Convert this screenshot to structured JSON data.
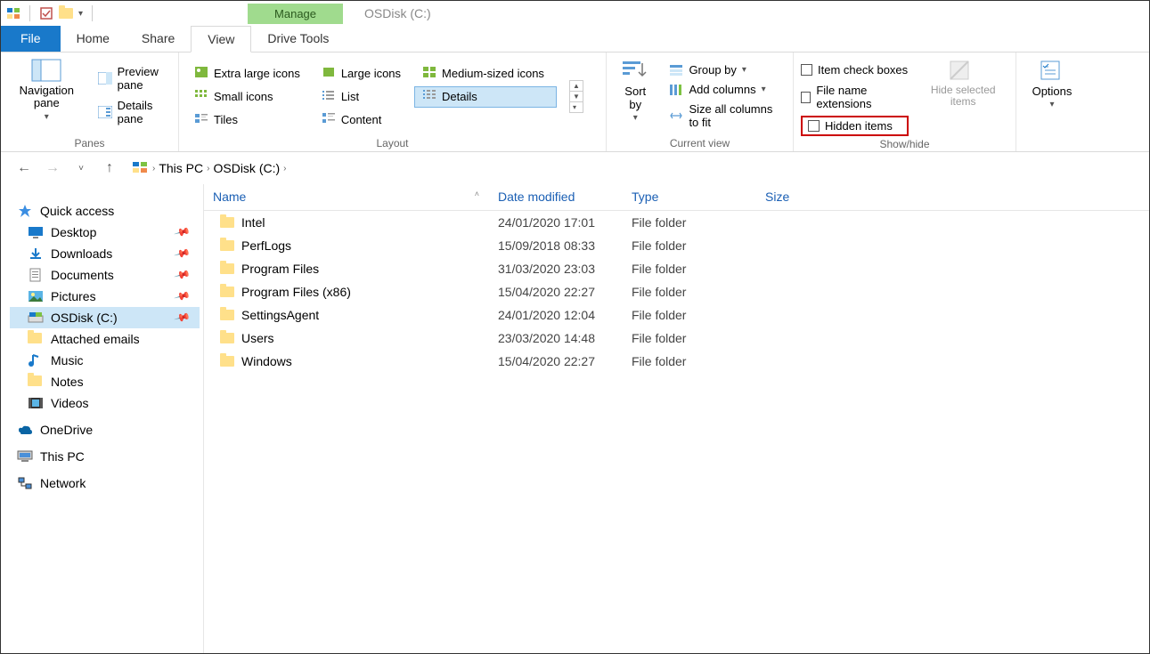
{
  "titlebar": {
    "manage_label": "Manage",
    "title": "OSDisk (C:)"
  },
  "tabs": {
    "file": "File",
    "home": "Home",
    "share": "Share",
    "view": "View",
    "drive_tools": "Drive Tools"
  },
  "ribbon": {
    "panes": {
      "navigation_pane": "Navigation pane",
      "preview_pane": "Preview pane",
      "details_pane": "Details pane",
      "label": "Panes"
    },
    "layout": {
      "extra_large_icons": "Extra large icons",
      "large_icons": "Large icons",
      "medium_icons": "Medium-sized icons",
      "small_icons": "Small icons",
      "list": "List",
      "details": "Details",
      "tiles": "Tiles",
      "content": "Content",
      "label": "Layout"
    },
    "current_view": {
      "sort_by": "Sort by",
      "group_by": "Group by",
      "add_columns": "Add columns",
      "size_all_columns": "Size all columns to fit",
      "label": "Current view"
    },
    "show_hide": {
      "item_check_boxes": "Item check boxes",
      "file_name_extensions": "File name extensions",
      "hidden_items": "Hidden items",
      "hide_selected": "Hide selected items",
      "label": "Show/hide"
    },
    "options": "Options"
  },
  "breadcrumb": {
    "this_pc": "This PC",
    "location": "OSDisk (C:)"
  },
  "columns": {
    "name": "Name",
    "date": "Date modified",
    "type": "Type",
    "size": "Size"
  },
  "navpane": {
    "quick_access": "Quick access",
    "desktop": "Desktop",
    "downloads": "Downloads",
    "documents": "Documents",
    "pictures": "Pictures",
    "osdisk": "OSDisk (C:)",
    "attached_emails": "Attached emails",
    "music": "Music",
    "notes": "Notes",
    "videos": "Videos",
    "onedrive": "OneDrive",
    "this_pc": "This PC",
    "network": "Network"
  },
  "files": [
    {
      "name": "Intel",
      "date": "24/01/2020 17:01",
      "type": "File folder",
      "size": ""
    },
    {
      "name": "PerfLogs",
      "date": "15/09/2018 08:33",
      "type": "File folder",
      "size": ""
    },
    {
      "name": "Program Files",
      "date": "31/03/2020 23:03",
      "type": "File folder",
      "size": ""
    },
    {
      "name": "Program Files (x86)",
      "date": "15/04/2020 22:27",
      "type": "File folder",
      "size": ""
    },
    {
      "name": "SettingsAgent",
      "date": "24/01/2020 12:04",
      "type": "File folder",
      "size": ""
    },
    {
      "name": "Users",
      "date": "23/03/2020 14:48",
      "type": "File folder",
      "size": ""
    },
    {
      "name": "Windows",
      "date": "15/04/2020 22:27",
      "type": "File folder",
      "size": ""
    }
  ]
}
